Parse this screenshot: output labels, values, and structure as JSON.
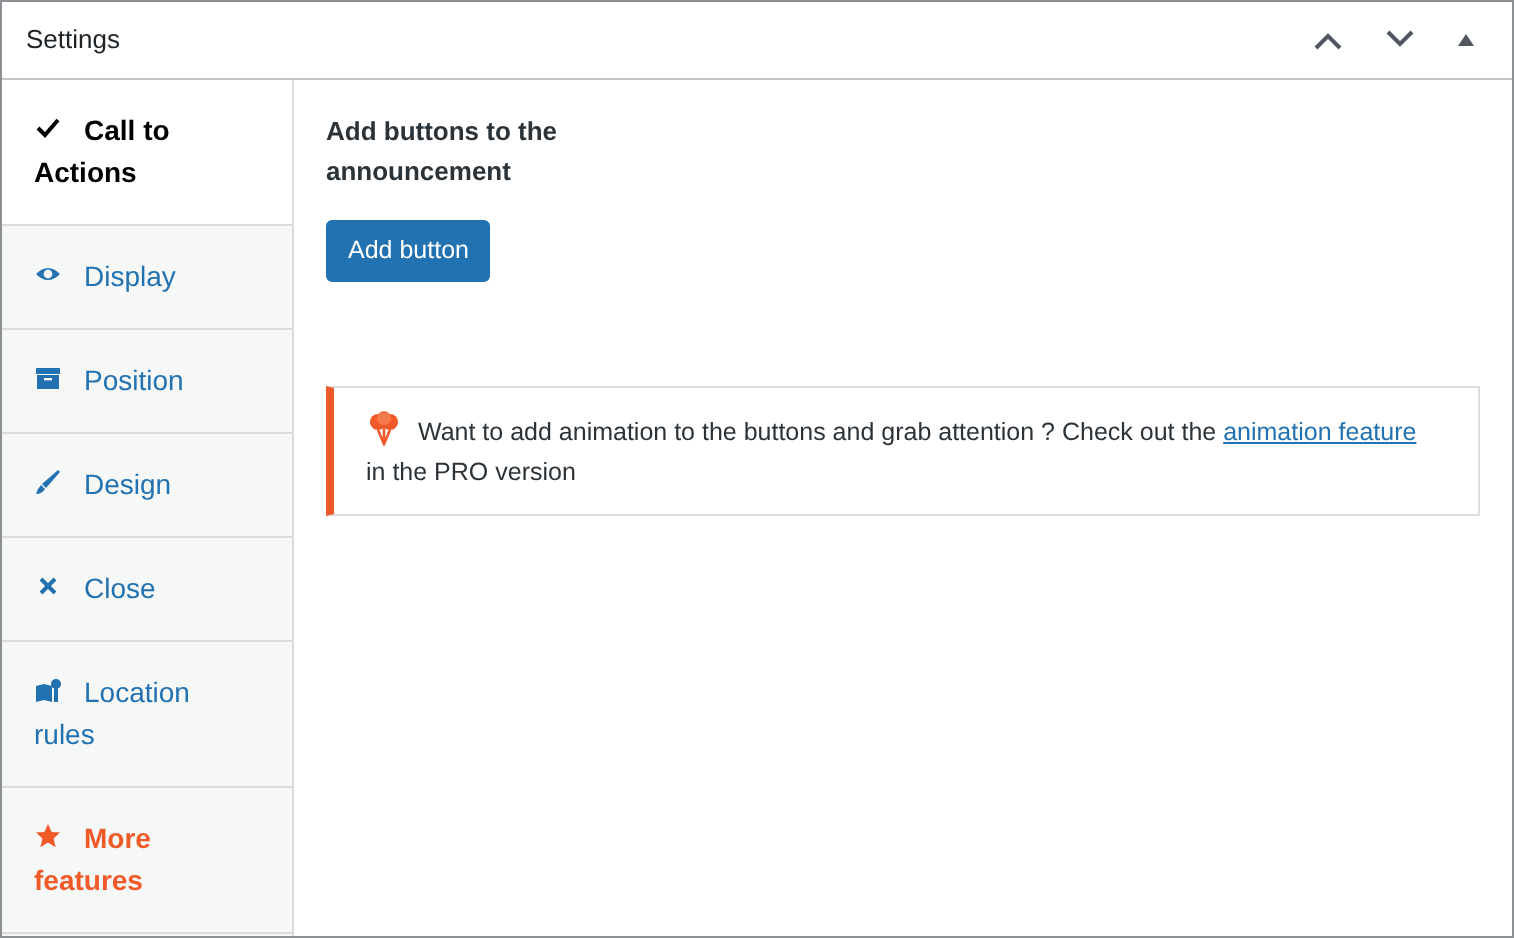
{
  "panel": {
    "title": "Settings"
  },
  "tabs": [
    {
      "label": "Call to Actions",
      "selected": true,
      "kind": "normal"
    },
    {
      "label": "Display",
      "selected": false,
      "kind": "normal"
    },
    {
      "label": "Position",
      "selected": false,
      "kind": "normal"
    },
    {
      "label": "Design",
      "selected": false,
      "kind": "normal"
    },
    {
      "label": "Close",
      "selected": false,
      "kind": "normal"
    },
    {
      "label": "Location rules",
      "selected": false,
      "kind": "normal"
    },
    {
      "label": "More features",
      "selected": false,
      "kind": "promo"
    }
  ],
  "content": {
    "heading": "Add buttons to the announcement",
    "button": "Add button",
    "notice": {
      "before": "Want to add animation to the buttons and grab attention ? Check out the",
      "link": "animation feature",
      "after": "in the PRO version"
    }
  }
}
